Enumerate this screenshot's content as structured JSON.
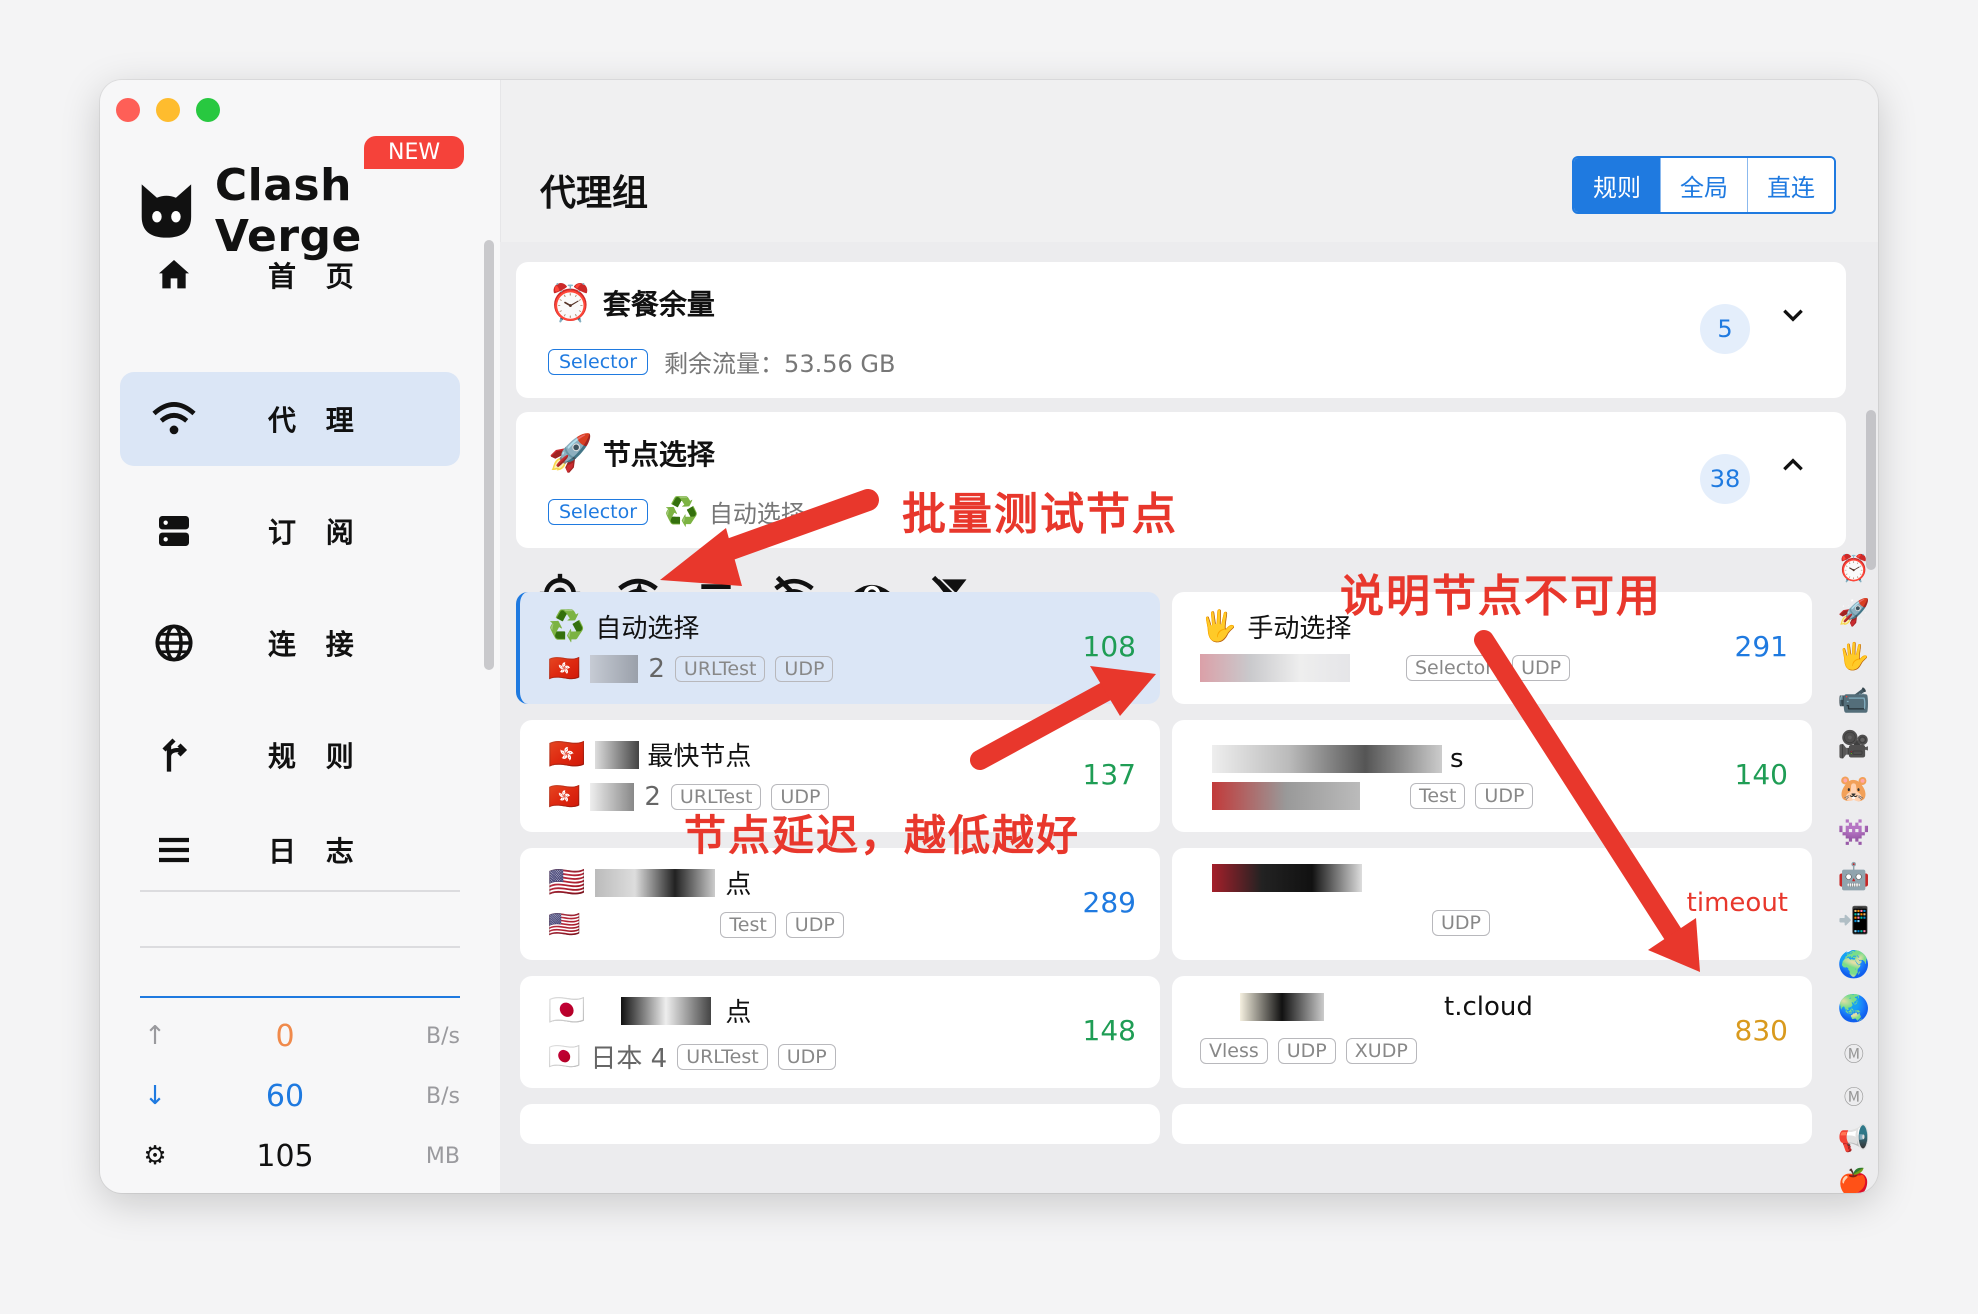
{
  "app": {
    "name": "Clash Verge",
    "new_badge": "NEW"
  },
  "sidebar": {
    "items": [
      {
        "label": "首 页",
        "icon": "home-icon"
      },
      {
        "label": "代 理",
        "icon": "wifi-icon"
      },
      {
        "label": "订 阅",
        "icon": "server-icon"
      },
      {
        "label": "连 接",
        "icon": "globe-icon"
      },
      {
        "label": "规 则",
        "icon": "fork-icon"
      },
      {
        "label": "日 志",
        "icon": "list-icon"
      }
    ],
    "stats": [
      {
        "icon": "↑",
        "value": "0",
        "unit": "B/s",
        "color": "#f08a4b"
      },
      {
        "icon": "↓",
        "value": "60",
        "unit": "B/s",
        "color": "#1f7ae0"
      },
      {
        "icon": "⚙",
        "value": "105",
        "unit": "MB",
        "color": "#111111"
      }
    ]
  },
  "header": {
    "title": "代理组",
    "modes": [
      "规则",
      "全局",
      "直连"
    ],
    "active_mode": "规则"
  },
  "groups": [
    {
      "icon": "⏰",
      "name": "套餐余量",
      "type": "Selector",
      "detail": "剩余流量：53.56 GB",
      "count": "5",
      "chev": "⌄"
    },
    {
      "icon": "🚀",
      "name": "节点选择",
      "type": "Selector",
      "detail": "自动选择",
      "detail_icon": "♻️",
      "count": "38",
      "chev": "⌃"
    }
  ],
  "cards": [
    {
      "name": "自动选择",
      "icon": "♻️",
      "sub_icon": "🇭🇰",
      "sub": "2",
      "tags": [
        "URLTest",
        "UDP"
      ],
      "latency": "108",
      "lat_color": "#1f9d55",
      "selected": true
    },
    {
      "name": "手动选择",
      "icon": "🖐",
      "sub_icon": "",
      "sub": "",
      "tags": [
        "Selector",
        "UDP"
      ],
      "latency": "291",
      "lat_color": "#1f7ae0",
      "selected": false
    },
    {
      "name": "最快节点",
      "icon": "🇭🇰",
      "sub_icon": "🇭🇰",
      "sub": "2",
      "tags": [
        "URLTest",
        "UDP"
      ],
      "latency": "137",
      "lat_color": "#1f9d55",
      "selected": false
    },
    {
      "name": "s",
      "icon": "",
      "sub_icon": "",
      "sub": "",
      "tags": [
        "Test",
        "UDP"
      ],
      "latency": "140",
      "lat_color": "#1f9d55",
      "selected": false
    },
    {
      "name": "点",
      "icon": "🇺🇸",
      "sub_icon": "🇺🇸",
      "sub": "",
      "tags": [
        "Test",
        "UDP"
      ],
      "latency": "289",
      "lat_color": "#1f7ae0",
      "selected": false
    },
    {
      "name": "",
      "icon": "",
      "sub_icon": "",
      "sub": "",
      "tags": [
        "UDP"
      ],
      "latency": "timeout",
      "lat_color": "#e8372c",
      "selected": false
    },
    {
      "name": "点",
      "icon": "🇯🇵",
      "sub_icon": "🇯🇵",
      "sub": "日本 4",
      "tags": [
        "URLTest",
        "UDP"
      ],
      "latency": "148",
      "lat_color": "#1f9d55",
      "selected": false
    },
    {
      "name": "t.cloud",
      "icon": "",
      "sub_icon": "",
      "sub": "",
      "tags": [
        "Vless",
        "UDP",
        "XUDP"
      ],
      "latency": "830",
      "lat_color": "#d99a1e",
      "selected": false
    }
  ],
  "rail_icons": [
    "⏰",
    "🚀",
    "🖐",
    "📹",
    "🎥",
    "🐹",
    "👾",
    "🤖",
    "📲",
    "🌍",
    "🌏",
    "Ⓜ",
    "Ⓜ",
    "📢",
    "🍎",
    "🎮",
    "♻️"
  ],
  "annotations": {
    "batch_test": "批量测试节点",
    "unavailable": "说明节点不可用",
    "latency_note": "节点延迟，越低越好"
  }
}
